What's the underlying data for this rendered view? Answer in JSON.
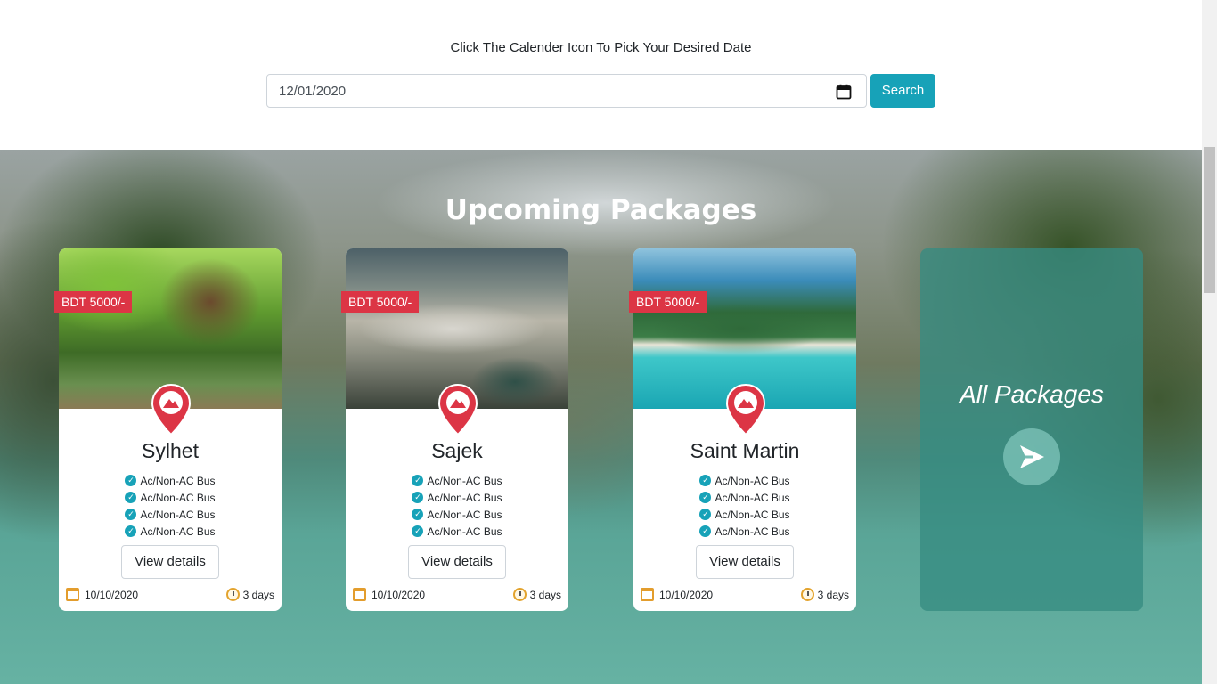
{
  "date_picker": {
    "caption": "Click The Calender Icon To Pick Your Desired Date",
    "value": "12/01/2020",
    "search_label": "Search"
  },
  "section": {
    "title": "Upcoming Packages"
  },
  "packages": [
    {
      "price": "BDT 5000/-",
      "name": "Sylhet",
      "features": [
        "Ac/Non-AC Bus",
        "Ac/Non-AC Bus",
        "Ac/Non-AC Bus",
        "Ac/Non-AC Bus"
      ],
      "details_label": "View details",
      "date": "10/10/2020",
      "duration": "3 days"
    },
    {
      "price": "BDT 5000/-",
      "name": "Sajek",
      "features": [
        "Ac/Non-AC Bus",
        "Ac/Non-AC Bus",
        "Ac/Non-AC Bus",
        "Ac/Non-AC Bus"
      ],
      "details_label": "View details",
      "date": "10/10/2020",
      "duration": "3 days"
    },
    {
      "price": "BDT 5000/-",
      "name": "Saint Martin",
      "features": [
        "Ac/Non-AC Bus",
        "Ac/Non-AC Bus",
        "Ac/Non-AC Bus",
        "Ac/Non-AC Bus"
      ],
      "details_label": "View details",
      "date": "10/10/2020",
      "duration": "3 days"
    }
  ],
  "all_packages": {
    "label": "All Packages"
  },
  "colors": {
    "accent": "#17a2b8",
    "price_badge": "#dc3545",
    "pin": "#dc3545"
  },
  "icons": {
    "calendar": "calendar-icon",
    "check": "check-circle-icon",
    "pin": "map-pin-icon",
    "clock": "clock-icon",
    "arrow": "send-arrow-icon"
  }
}
